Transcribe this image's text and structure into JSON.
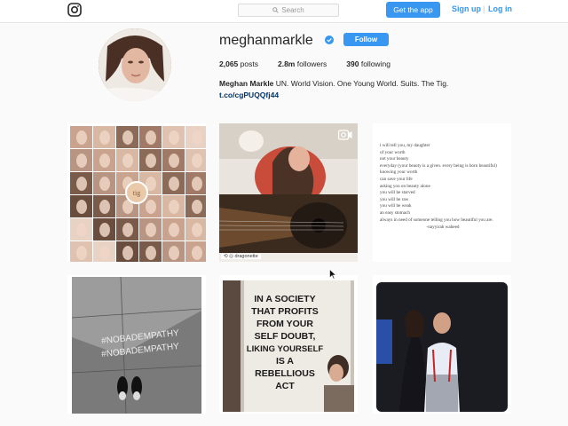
{
  "header": {
    "search_placeholder": "Search",
    "get_app_label": "Get the app",
    "signup_label": "Sign up",
    "separator": "|",
    "login_label": "Log in"
  },
  "profile": {
    "username": "meghanmarkle",
    "follow_label": "Follow",
    "posts_count": "2,065",
    "posts_label": "posts",
    "followers_count": "2.8m",
    "followers_label": "followers",
    "following_count": "390",
    "following_label": "following",
    "full_name": "Meghan Markle",
    "bio": "UN. World Vision. One Young World. Suits. The Tig.",
    "link": "t.co/cgPUQQfj44"
  },
  "posts": {
    "video_tag": "dragonette",
    "poem_lines": [
      "i will tell you, my daughter",
      "of your worth",
      "not your beauty",
      "everyday (your beauty is a given. every being is born beautiful)",
      "knowing your worth",
      "can save your life",
      "asking you on beauty alone",
      "you will be starved",
      "you will be raw",
      "you will be weak",
      "an easy stomach",
      "always in need of someone telling you how beautiful you are."
    ],
    "poem_signature": "-nayyirah waheed",
    "sign_text": [
      "IN A SOCIETY",
      "THAT PROFITS",
      "FROM YOUR",
      "SELF DOUBT,",
      "LIKING YOURSELF",
      "IS A",
      "REBELLIOUS",
      "ACT"
    ],
    "chalk_text": [
      "#NOBADEMPATHY",
      "#NOBADEMPATHY"
    ]
  }
}
